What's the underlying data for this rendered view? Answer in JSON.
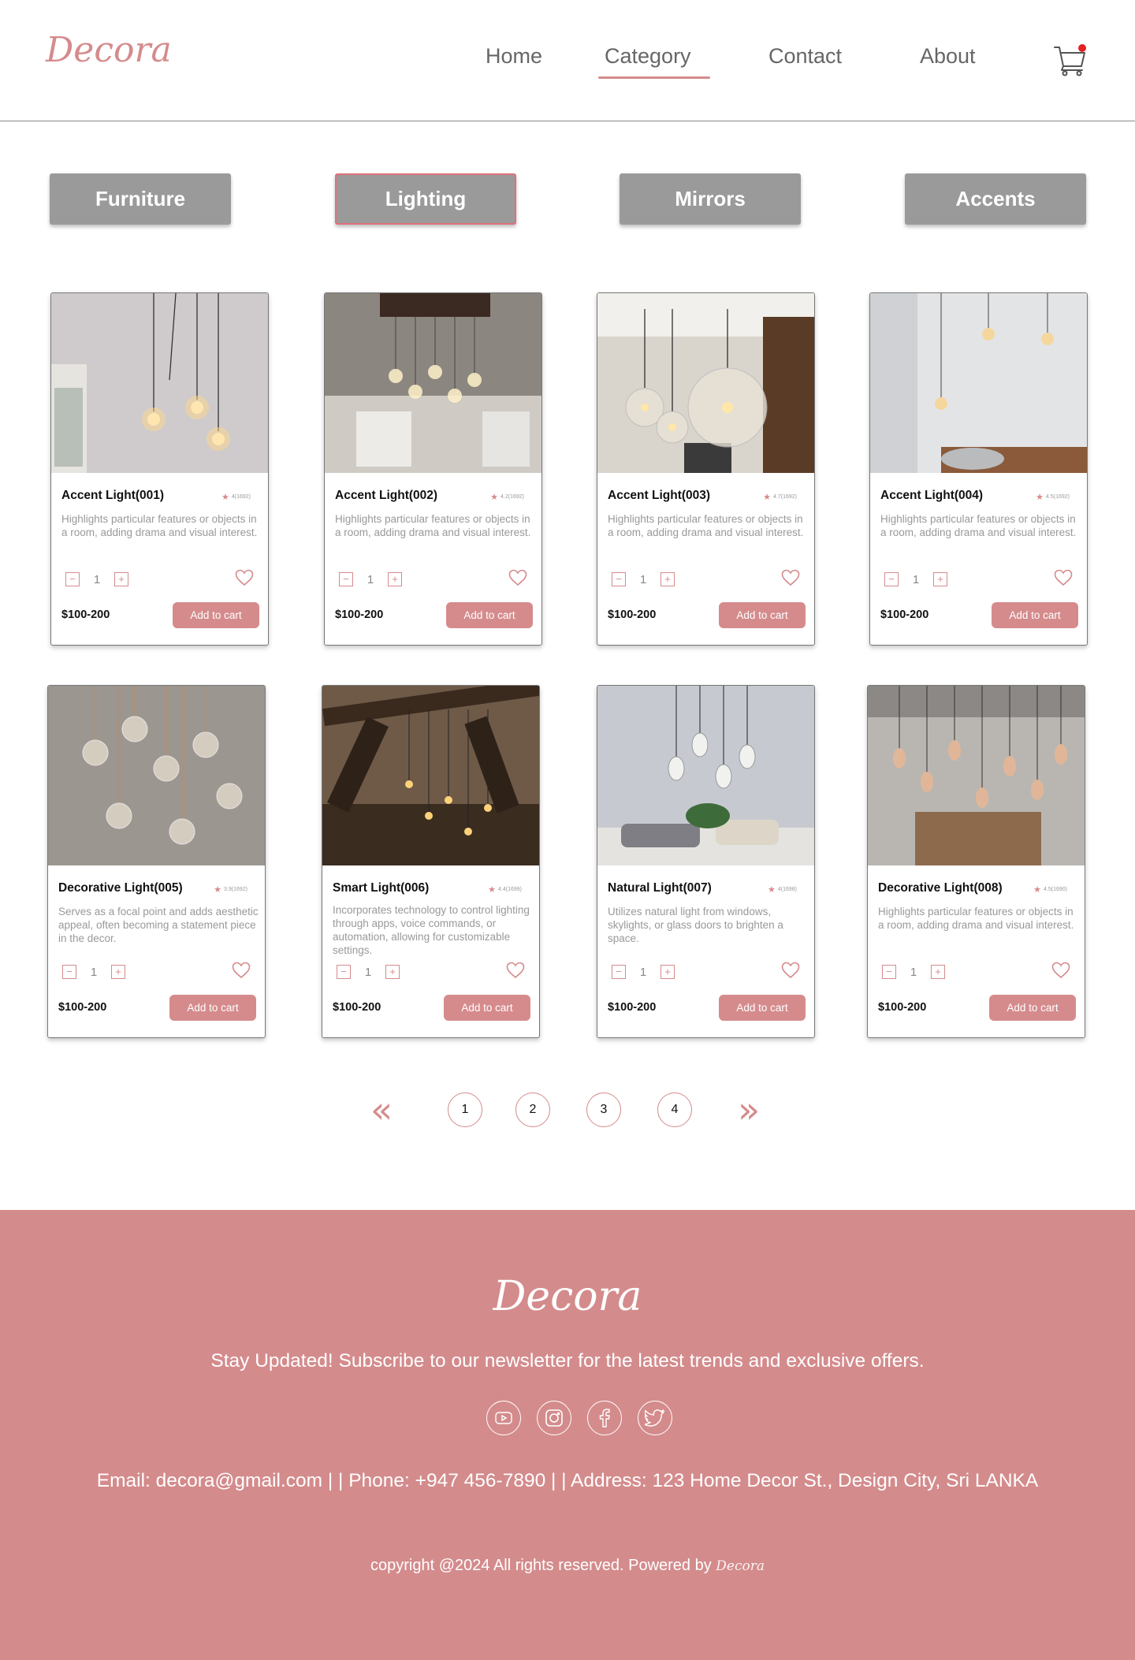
{
  "brand": {
    "logo_text": "Decora"
  },
  "nav": {
    "items": [
      "Home",
      "Category",
      "Contact",
      "About"
    ],
    "active": "Category"
  },
  "categories": {
    "items": [
      "Furniture",
      "Lighting",
      "Mirrors",
      "Accents"
    ],
    "active": "Lighting"
  },
  "products": [
    {
      "name": "Accent Light(001)",
      "rating": "4(1692)",
      "description": "Highlights particular features or objects in a room, adding drama and visual interest.",
      "quantity": "1",
      "price": "$100-200",
      "button": "Add to cart"
    },
    {
      "name": "Accent Light(002)",
      "rating": "4.2(1692)",
      "description": "Highlights particular features or objects in a room, adding drama and visual interest.",
      "quantity": "1",
      "price": "$100-200",
      "button": "Add to cart"
    },
    {
      "name": "Accent Light(003)",
      "rating": "4.7(1692)",
      "description": "Highlights particular features or objects in a room, adding drama and visual interest.",
      "quantity": "1",
      "price": "$100-200",
      "button": "Add to cart"
    },
    {
      "name": "Accent Light(004)",
      "rating": "4.5(1692)",
      "description": "Highlights particular features or objects in a room, adding drama and visual interest.",
      "quantity": "1",
      "price": "$100-200",
      "button": "Add to cart"
    },
    {
      "name": "Decorative Light(005)",
      "rating": "3.9(1692)",
      "description": "Serves as a focal point and adds aesthetic appeal, often becoming a statement piece in the decor.",
      "quantity": "1",
      "price": "$100-200",
      "button": "Add to cart"
    },
    {
      "name": "Smart Light(006)",
      "rating": "4.4(1699)",
      "description": "Incorporates technology to control lighting through apps, voice commands, or automation, allowing for customizable settings.",
      "quantity": "1",
      "price": "$100-200",
      "button": "Add to cart"
    },
    {
      "name": "Natural Light(007)",
      "rating": "4(1698)",
      "description": "Utilizes natural light from windows, skylights, or glass doors to brighten a space.",
      "quantity": "1",
      "price": "$100-200",
      "button": "Add to cart"
    },
    {
      "name": "Decorative Light(008)",
      "rating": "4.5(1690)",
      "description": "Highlights particular features or objects in a room, adding drama and visual interest.",
      "quantity": "1",
      "price": "$100-200",
      "button": "Add to cart"
    }
  ],
  "pagination": {
    "prev": "«",
    "next": "»",
    "pages": [
      "1",
      "2",
      "3",
      "4"
    ]
  },
  "footer": {
    "logo_text": "Decora",
    "newsletter": "Stay Updated! Subscribe to our newsletter for the latest trends and exclusive offers.",
    "socials": [
      "youtube-icon",
      "instagram-icon",
      "facebook-icon",
      "twitter-icon"
    ],
    "contact": "Email: decora@gmail.com | | Phone: +947 456-7890 | | Address: 123 Home Decor St., Design City, Sri LANKA",
    "copyright": "copyright @2024 All rights reserved. Powered by",
    "powered_by_logo": "Decora"
  },
  "colors": {
    "accent": "#d58b8c",
    "footer_bg": "#d48b8c",
    "tab_bg": "#9a9a9a",
    "cart_dot": "#e52020"
  }
}
